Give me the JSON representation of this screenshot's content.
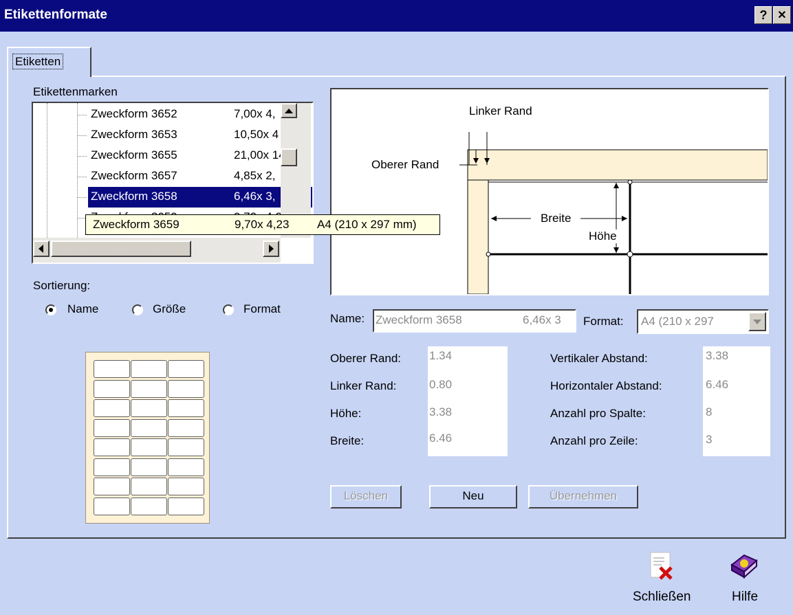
{
  "window": {
    "title": "Etikettenformate",
    "help_glyph": "?",
    "close_glyph": "✕"
  },
  "tabs": [
    {
      "label": "Etiketten"
    }
  ],
  "labels_list": {
    "heading": "Etikettenmarken",
    "items": [
      {
        "name": "Zweckform 3652",
        "size": "7,00x 4,"
      },
      {
        "name": "Zweckform 3653",
        "size": "10,50x 4"
      },
      {
        "name": "Zweckform 3655",
        "size": "21,00x 14"
      },
      {
        "name": "Zweckform 3657",
        "size": "4,85x 2,"
      },
      {
        "name": "Zweckform 3658",
        "size": "6,46x 3,"
      },
      {
        "name": "Zweckform 3659",
        "size": "9,70x 4,23"
      }
    ],
    "selected_index": 4,
    "tooltip": {
      "name": "Zweckform 3659",
      "size": "9,70x 4,23",
      "format": "A4 (210 x 297 mm)"
    }
  },
  "sorting": {
    "label": "Sortierung:",
    "options": [
      "Name",
      "Größe",
      "Format"
    ],
    "selected": "Name"
  },
  "diagram": {
    "left_margin": "Linker Rand",
    "top_margin": "Oberer Rand",
    "width": "Breite",
    "height": "Höhe"
  },
  "form": {
    "name_label": "Name:",
    "name_value": "Zweckform 3658",
    "name_size": "6,46x 3",
    "format_label": "Format:",
    "format_value": "A4 (210 x 297",
    "oberer_rand_label": "Oberer Rand:",
    "oberer_rand": "1.34",
    "linker_rand_label": "Linker Rand:",
    "linker_rand": "0.80",
    "hoehe_label": "Höhe:",
    "hoehe": "3.38",
    "breite_label": "Breite:",
    "breite": "6.46",
    "vert_label": "Vertikaler Abstand:",
    "vert": "3.38",
    "horiz_label": "Horizontaler Abstand:",
    "horiz": "6.46",
    "spalte_label": "Anzahl pro Spalte:",
    "spalte": "8",
    "zeile_label": "Anzahl pro Zeile:",
    "zeile": "3"
  },
  "buttons": {
    "delete": "Löschen",
    "new": "Neu",
    "apply": "Übernehmen"
  },
  "footer": {
    "close": "Schließen",
    "help": "Hilfe"
  }
}
